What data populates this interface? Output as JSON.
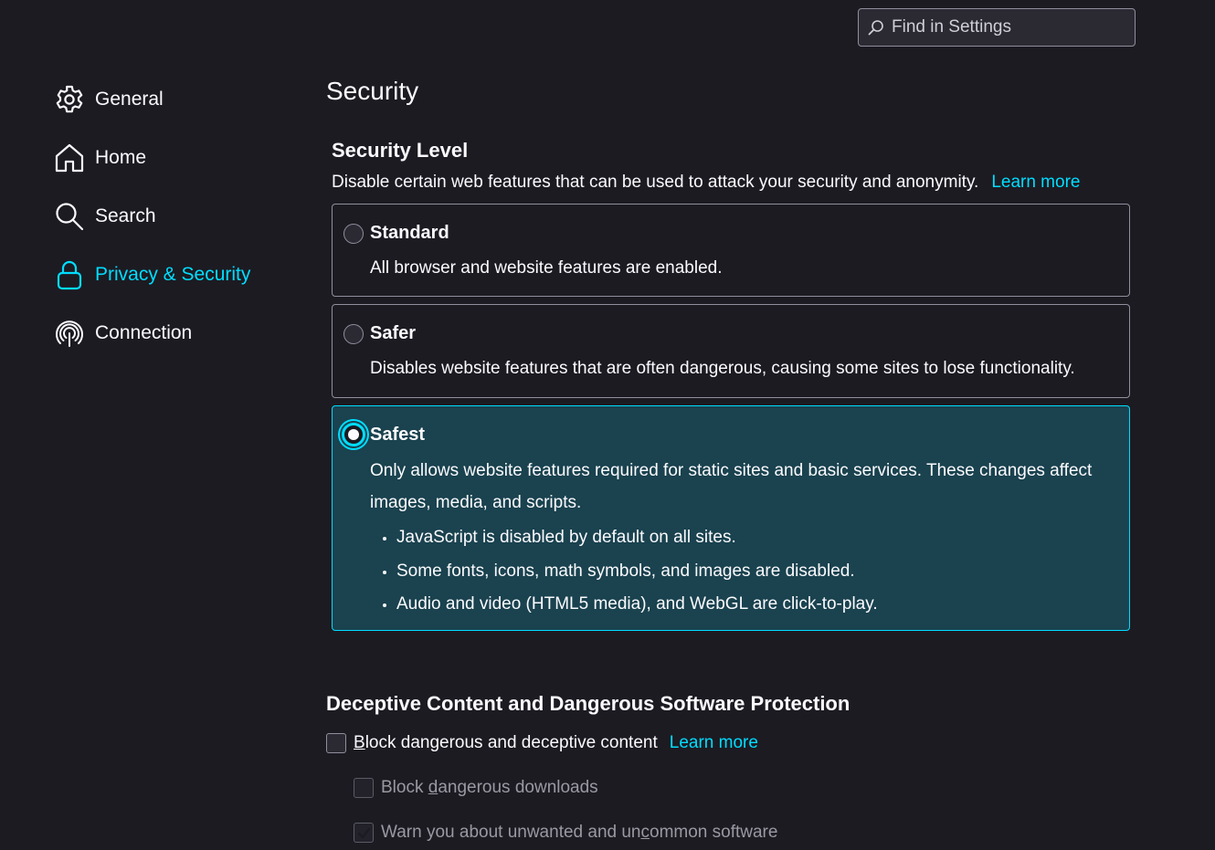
{
  "search": {
    "placeholder": "Find in Settings"
  },
  "sidebar": {
    "items": [
      {
        "label": "General",
        "icon": "gear-icon"
      },
      {
        "label": "Home",
        "icon": "home-icon"
      },
      {
        "label": "Search",
        "icon": "magnifier-icon"
      },
      {
        "label": "Privacy & Security",
        "icon": "lock-icon",
        "active": true
      },
      {
        "label": "Connection",
        "icon": "onion-icon"
      }
    ]
  },
  "main": {
    "title": "Security",
    "security_level": {
      "heading": "Security Level",
      "description": "Disable certain web features that can be used to attack your security and anonymity.",
      "learn_more": "Learn more",
      "options": [
        {
          "title": "Standard",
          "description": "All browser and website features are enabled.",
          "selected": false
        },
        {
          "title": "Safer",
          "description": "Disables website features that are often dangerous, causing some sites to lose functionality.",
          "selected": false
        },
        {
          "title": "Safest",
          "description": "Only allows website features required for static sites and basic services. These changes affect images, media, and scripts.",
          "selected": true,
          "bullets": [
            "JavaScript is disabled by default on all sites.",
            "Some fonts, icons, math symbols, and images are disabled.",
            "Audio and video (HTML5 media), and WebGL are click-to-play."
          ]
        }
      ]
    },
    "deceptive": {
      "heading": "Deceptive Content and Dangerous Software Protection",
      "block_content": {
        "label_accesskey": "B",
        "label_rest": "lock dangerous and deceptive content",
        "checked": false
      },
      "learn_more": "Learn more",
      "block_downloads": {
        "label_pre": "Block ",
        "label_accesskey": "d",
        "label_rest": "angerous downloads",
        "checked": false,
        "disabled": true
      },
      "warn_unwanted": {
        "label_pre": "Warn you about unwanted and un",
        "label_accesskey": "c",
        "label_rest": "ommon software",
        "checked": true,
        "disabled": true
      }
    }
  },
  "colors": {
    "background": "#1c1b22",
    "accent": "#00ddff",
    "selected_bg": "#1a424f"
  }
}
